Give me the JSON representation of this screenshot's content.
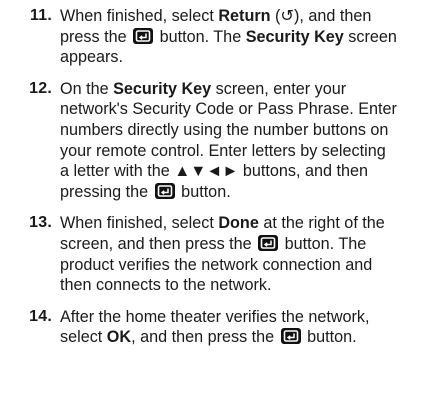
{
  "steps": [
    {
      "number": "11.",
      "lines": [
        [
          "When finished, select ",
          "Return",
          " (",
          "↺",
          "), and then"
        ],
        [
          "press the ",
          " button. The ",
          "Security Key",
          " screen"
        ],
        [
          "appears."
        ]
      ]
    },
    {
      "number": "12.",
      "lines": [
        [
          "On the ",
          "Security Key",
          " screen, enter your"
        ],
        [
          "network's Security Code or Pass Phrase. Enter"
        ],
        [
          "numbers directly using the number buttons on"
        ],
        [
          "your remote control. Enter letters by selecting"
        ],
        [
          "a letter with the ▲▼◄► buttons, and then"
        ],
        [
          "pressing the ",
          " button."
        ]
      ]
    },
    {
      "number": "13.",
      "lines": [
        [
          "When finished, select ",
          "Done",
          " at the right of the"
        ],
        [
          "screen, and then press the ",
          " button. The"
        ],
        [
          "product verifies the network connection and"
        ],
        [
          "then connects to the network."
        ]
      ]
    },
    {
      "number": "14.",
      "lines": [
        [
          "After the home theater verifies the network,"
        ],
        [
          "select ",
          "OK",
          ", and then press the ",
          " button."
        ]
      ]
    }
  ],
  "icons": {
    "enter_button": "enter-button-icon",
    "return_symbol": "return-icon"
  }
}
